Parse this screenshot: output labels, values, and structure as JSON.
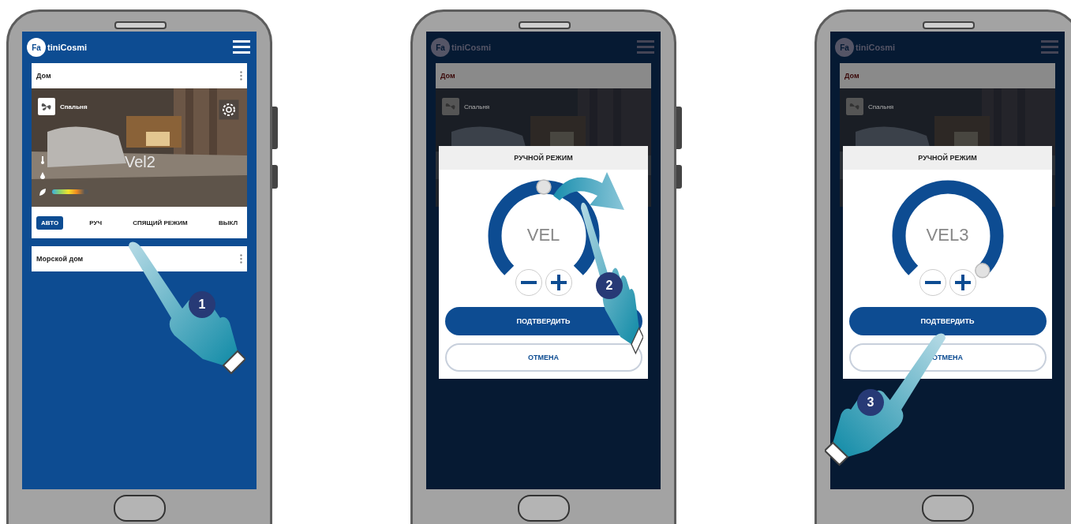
{
  "phones": [
    {
      "kind": "home",
      "header": {
        "logo_mark": "Fa",
        "logo_text": "tiniCosmi"
      },
      "homes": [
        {
          "name": "Дом",
          "expanded": true,
          "room": "Спальня",
          "speed": "Vel2",
          "modes": [
            {
              "label": "АВТО",
              "selected": true
            },
            {
              "label": "РУЧ",
              "selected": false
            },
            {
              "label": "СПЯЩИЙ РЕЖИМ",
              "selected": false
            },
            {
              "label": "ВЫКЛ",
              "selected": false
            }
          ]
        },
        {
          "name": "Морской дом",
          "expanded": false
        }
      ],
      "hand": {
        "step": "1",
        "kind": "tap"
      }
    },
    {
      "kind": "dialog",
      "header": {
        "logo_mark": "Fa",
        "logo_text": "tiniCosmi"
      },
      "home": "Дом",
      "room": "Спальня",
      "dialog": {
        "title": "РУЧНОЙ РЕЖИМ",
        "value": "VEL",
        "confirm": "ПОДТВЕРДИТЬ",
        "cancel": "ОТМЕНА"
      },
      "hand": {
        "step": "2",
        "kind": "swipe"
      }
    },
    {
      "kind": "dialog",
      "header": {
        "logo_mark": "Fa",
        "logo_text": "tiniCosmi"
      },
      "home": "Дом",
      "room": "Спальня",
      "dialog": {
        "title": "РУЧНОЙ РЕЖИМ",
        "value": "VEL3",
        "confirm": "ПОДТВЕРДИТЬ",
        "cancel": "ОТМЕНА"
      },
      "hand": {
        "step": "3",
        "kind": "tap"
      }
    }
  ]
}
